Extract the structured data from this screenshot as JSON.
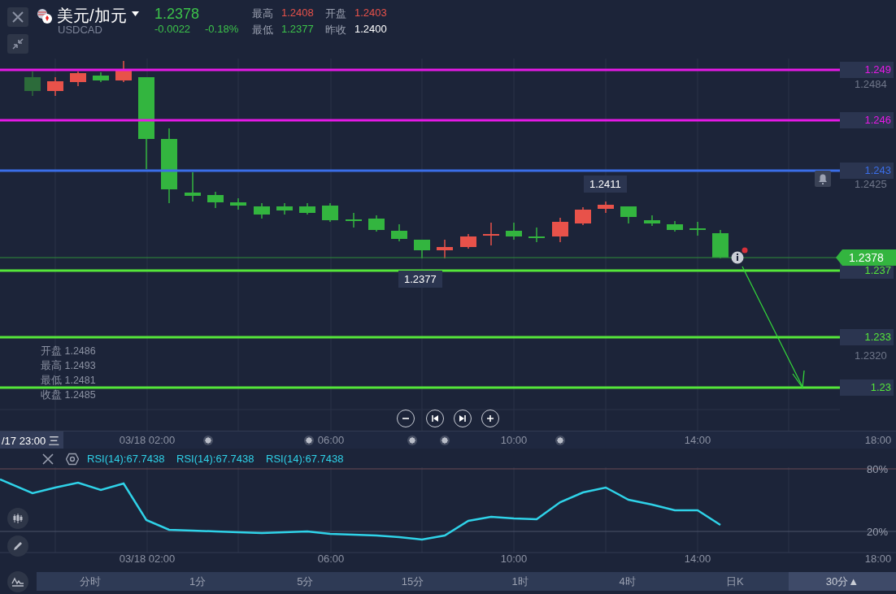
{
  "header": {
    "pair": "美元/加元",
    "symbol": "USDCAD",
    "price": "1.2378",
    "change": "-0.0022",
    "change_pct": "-0.18%",
    "stats": [
      {
        "label": "最高",
        "value": "1.2408",
        "color": "#e8524a"
      },
      {
        "label": "开盘",
        "value": "1.2403",
        "color": "#e8524a"
      },
      {
        "label": "最低",
        "value": "1.2377",
        "color": "#3cc24a"
      },
      {
        "label": "昨收",
        "value": "1.2400",
        "color": "#ffffff"
      }
    ]
  },
  "chart": {
    "price_axis": [
      "1.2484",
      "1.2425",
      "1.2320"
    ],
    "levels": [
      {
        "label": "1.249",
        "color": "#e619e6"
      },
      {
        "label": "1.246",
        "color": "#e619e6"
      },
      {
        "label": "1.243",
        "color": "#3a6ee8"
      },
      {
        "label": "1.237",
        "color": "#55e63a"
      },
      {
        "label": "1.233",
        "color": "#55e63a"
      },
      {
        "label": "1.23",
        "color": "#55e63a"
      }
    ],
    "current_price": "1.2378",
    "high_marker": "1.2411",
    "low_marker": "1.2377",
    "ohlc": [
      {
        "label": "开盘",
        "value": "1.2486"
      },
      {
        "label": "最高",
        "value": "1.2493"
      },
      {
        "label": "最低",
        "value": "1.2481"
      },
      {
        "label": "收盘",
        "value": "1.2485"
      }
    ],
    "time_axis": {
      "cursor": "/17 23:00 三",
      "labels": [
        "03/18 02:00",
        "06:00",
        "10:00",
        "14:00",
        "18:00"
      ]
    }
  },
  "rsi": {
    "labels": [
      "RSI(14):67.7438",
      "RSI(14):67.7438",
      "RSI(14):67.7438"
    ],
    "axis": [
      "80%",
      "20%"
    ],
    "time_labels": [
      "03/18 02:00",
      "06:00",
      "10:00",
      "14:00",
      "18:00"
    ]
  },
  "periods": [
    {
      "label": "分时",
      "selected": false
    },
    {
      "label": "1分",
      "selected": false
    },
    {
      "label": "5分",
      "selected": false
    },
    {
      "label": "15分",
      "selected": false
    },
    {
      "label": "1时",
      "selected": false
    },
    {
      "label": "4时",
      "selected": false
    },
    {
      "label": "日K",
      "selected": false
    },
    {
      "label": "30分▲",
      "selected": true
    }
  ]
}
